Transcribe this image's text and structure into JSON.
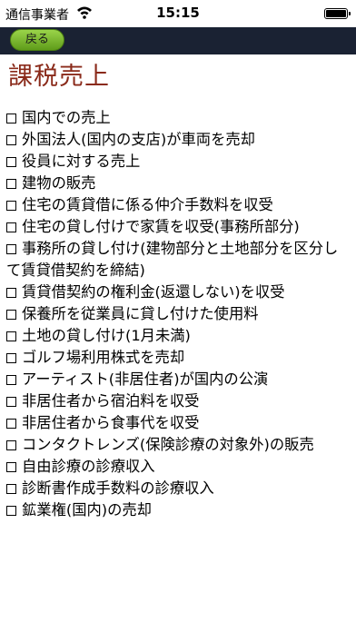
{
  "status_bar": {
    "carrier": "通信事業者",
    "time": "15:15",
    "wifi_icon": "wifi-icon",
    "battery_icon": "battery-icon"
  },
  "nav": {
    "back_label": "戻る"
  },
  "page": {
    "title": "課税売上"
  },
  "items": [
    "国内での売上",
    "外国法人(国内の支店)が車両を売却",
    "役員に対する売上",
    "建物の販売",
    "住宅の賃貸借に係る仲介手数料を収受",
    "住宅の貸し付けで家賃を収受(事務所部分)",
    "事務所の貸し付け(建物部分と土地部分を区分して賃貸借契約を締結)",
    "賃貸借契約の権利金(返還しない)を収受",
    "保養所を従業員に貸し付けた使用料",
    "土地の貸し付け(1月未満)",
    "ゴルフ場利用株式を売却",
    "アーティスト(非居住者)が国内の公演",
    "非居住者から宿泊料を収受",
    "非居住者から食事代を収受",
    "コンタクトレンズ(保険診療の対象外)の販売",
    "自由診療の診療収入",
    "診断書作成手数料の診療収入",
    "鉱業権(国内)の売却"
  ],
  "colors": {
    "nav_background": "#1a2233",
    "back_button": "#7fbf2f",
    "title": "#8a2a1a"
  }
}
